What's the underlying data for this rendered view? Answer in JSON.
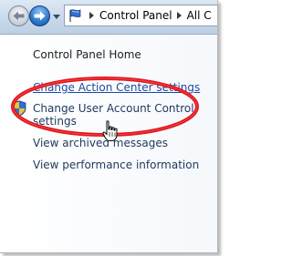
{
  "address_bar": {
    "breadcrumbs": [
      "Control Panel",
      "All C"
    ]
  },
  "nav": {
    "back_icon": "back-arrow-icon",
    "forward_icon": "forward-arrow-icon"
  },
  "tasks": {
    "home": "Control Panel Home",
    "action_center": "Change Action Center settings",
    "uac_line1": "Change User Account Control",
    "uac_line2": "settings",
    "archived": "View archived messages",
    "performance": "View performance information"
  },
  "annotation": {
    "highlight_color": "#e0141b",
    "target": "Change Action Center settings"
  },
  "colors": {
    "link": "#1e395b",
    "hover_link": "#1c4a9e",
    "shield_blue": "#2f6fd0",
    "shield_yellow": "#f3c230"
  }
}
